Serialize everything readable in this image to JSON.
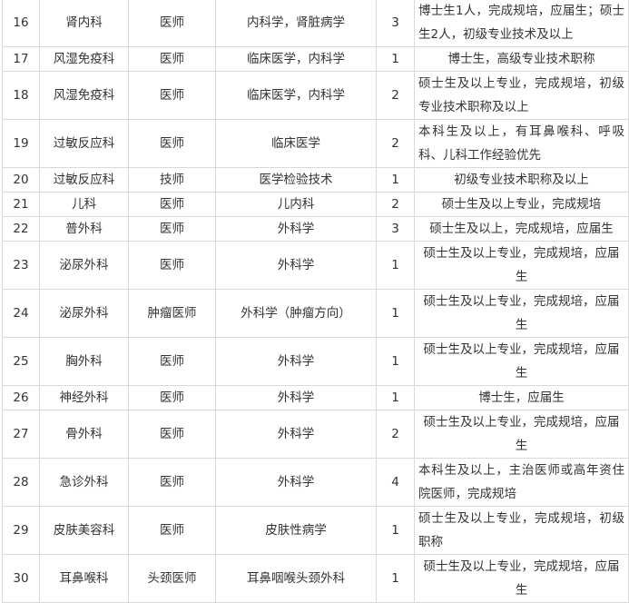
{
  "table": {
    "rows": [
      {
        "no": "16",
        "dept": "肾内科",
        "post": "医师",
        "major": "内科学，肾脏病学",
        "count": "3",
        "req": "博士生1人，完成规培，应届生；硕士生2人，初级专业技术及以上"
      },
      {
        "no": "17",
        "dept": "风湿免疫科",
        "post": "医师",
        "major": "临床医学，内科学",
        "count": "1",
        "req": "博士生，高级专业技术职称"
      },
      {
        "no": "18",
        "dept": "风湿免疫科",
        "post": "医师",
        "major": "临床医学，内科学",
        "count": "2",
        "req": "硕士生及以上专业，完成规培，初级专业技术职称及以上"
      },
      {
        "no": "19",
        "dept": "过敏反应科",
        "post": "医师",
        "major": "临床医学",
        "count": "2",
        "req": "本科生及以上，有耳鼻喉科、呼吸科、儿科工作经验优先"
      },
      {
        "no": "20",
        "dept": "过敏反应科",
        "post": "技师",
        "major": "医学检验技术",
        "count": "1",
        "req": "初级专业技术职称及以上"
      },
      {
        "no": "21",
        "dept": "儿科",
        "post": "医师",
        "major": "儿内科",
        "count": "2",
        "req": "硕士生及以上专业，完成规培"
      },
      {
        "no": "22",
        "dept": "普外科",
        "post": "医师",
        "major": "外科学",
        "count": "3",
        "req": "硕士生及以上，完成规培，应届生"
      },
      {
        "no": "23",
        "dept": "泌尿外科",
        "post": "医师",
        "major": "外科学",
        "count": "1",
        "req": "硕士生及以上专业，完成规培，应届生"
      },
      {
        "no": "24",
        "dept": "泌尿外科",
        "post": "肿瘤医师",
        "major": "外科学（肿瘤方向）",
        "count": "1",
        "req": "硕士生及以上专业，完成规培，应届生"
      },
      {
        "no": "25",
        "dept": "胸外科",
        "post": "医师",
        "major": "外科学",
        "count": "1",
        "req": "硕士生及以上专业，完成规培，应届生"
      },
      {
        "no": "26",
        "dept": "神经外科",
        "post": "医师",
        "major": "外科学",
        "count": "1",
        "req": "博士生，应届生"
      },
      {
        "no": "27",
        "dept": "骨外科",
        "post": "医师",
        "major": "外科学",
        "count": "2",
        "req": "硕士生及以上专业，完成规培，应届生"
      },
      {
        "no": "28",
        "dept": "急诊外科",
        "post": "医师",
        "major": "外科学",
        "count": "4",
        "req": "本科生及以上，主治医师或高年资住院医师，完成规培"
      },
      {
        "no": "29",
        "dept": "皮肤美容科",
        "post": "医师",
        "major": "皮肤性病学",
        "count": "1",
        "req": "硕士生及以上专业，完成规培，初级职称"
      },
      {
        "no": "30",
        "dept": "耳鼻喉科",
        "post": "头颈医师",
        "major": "耳鼻咽喉头颈外科",
        "count": "1",
        "req": "硕士生及以上专业，完成规培，应届生"
      }
    ]
  }
}
